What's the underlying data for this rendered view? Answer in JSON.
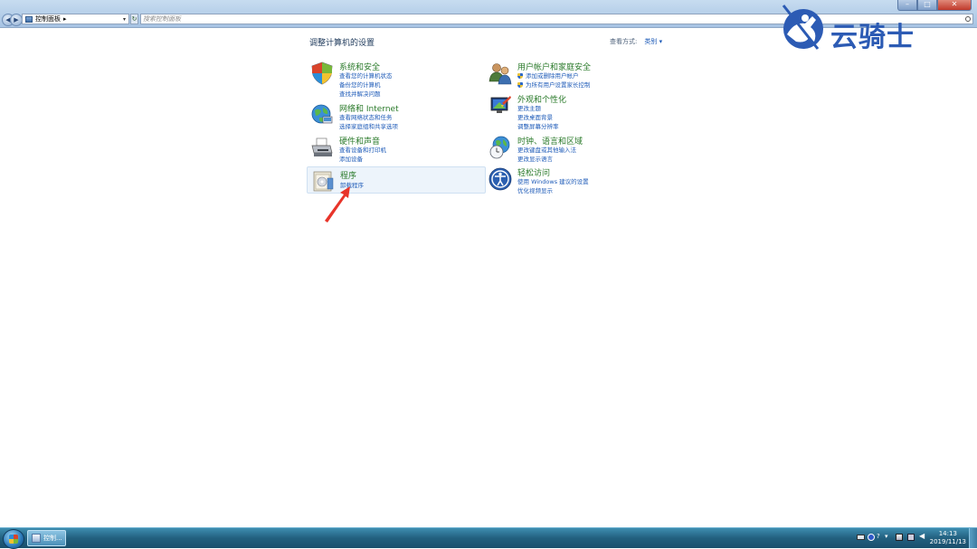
{
  "window": {
    "address_label": "控制面板",
    "search_placeholder": "搜索控制面板"
  },
  "watermark": {
    "text": "云骑士"
  },
  "header": {
    "title": "调整计算机的设置",
    "view_by_label": "查看方式:",
    "view_by_value": "类别"
  },
  "categories": [
    {
      "title": "系统和安全",
      "icon": "shield-icon",
      "links": [
        "查看您的计算机状态",
        "备份您的计算机",
        "查找并解决问题"
      ]
    },
    {
      "title": "网络和 Internet",
      "icon": "network-globe-icon",
      "links": [
        "查看网络状态和任务",
        "选择家庭组和共享选项"
      ]
    },
    {
      "title": "硬件和声音",
      "icon": "printer-icon",
      "links": [
        "查看设备和打印机",
        "添加设备"
      ]
    },
    {
      "title": "程序",
      "icon": "programs-icon",
      "links": [
        "卸载程序"
      ]
    },
    {
      "title": "用户帐户和家庭安全",
      "icon": "users-icon",
      "links": [
        "添加或删除用户帐户",
        "为所有用户设置家长控制"
      ]
    },
    {
      "title": "外观和个性化",
      "icon": "monitor-paint-icon",
      "links": [
        "更改主题",
        "更改桌面背景",
        "调整屏幕分辨率"
      ]
    },
    {
      "title": "时钟、语言和区域",
      "icon": "clock-globe-icon",
      "links": [
        "更改键盘或其他输入法",
        "更改显示语言"
      ]
    },
    {
      "title": "轻松访问",
      "icon": "accessibility-icon",
      "links": [
        "使用 Windows 建议的设置",
        "优化视频显示"
      ]
    }
  ],
  "taskbar": {
    "button_label": "控制...",
    "time": "14:13",
    "date": "2019/11/13"
  }
}
